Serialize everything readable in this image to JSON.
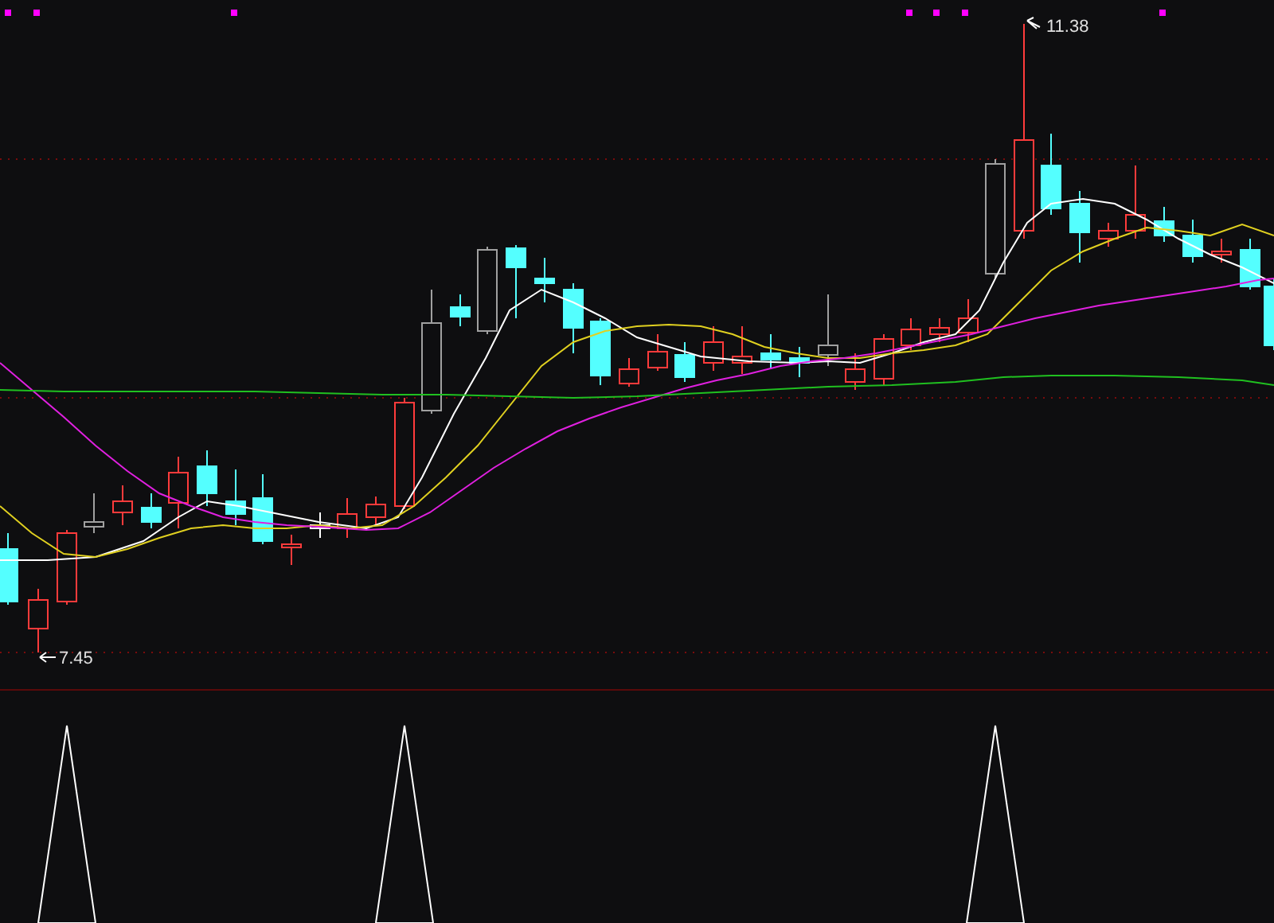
{
  "chart": {
    "high_label": "11.38",
    "low_label": "7.45"
  }
}
